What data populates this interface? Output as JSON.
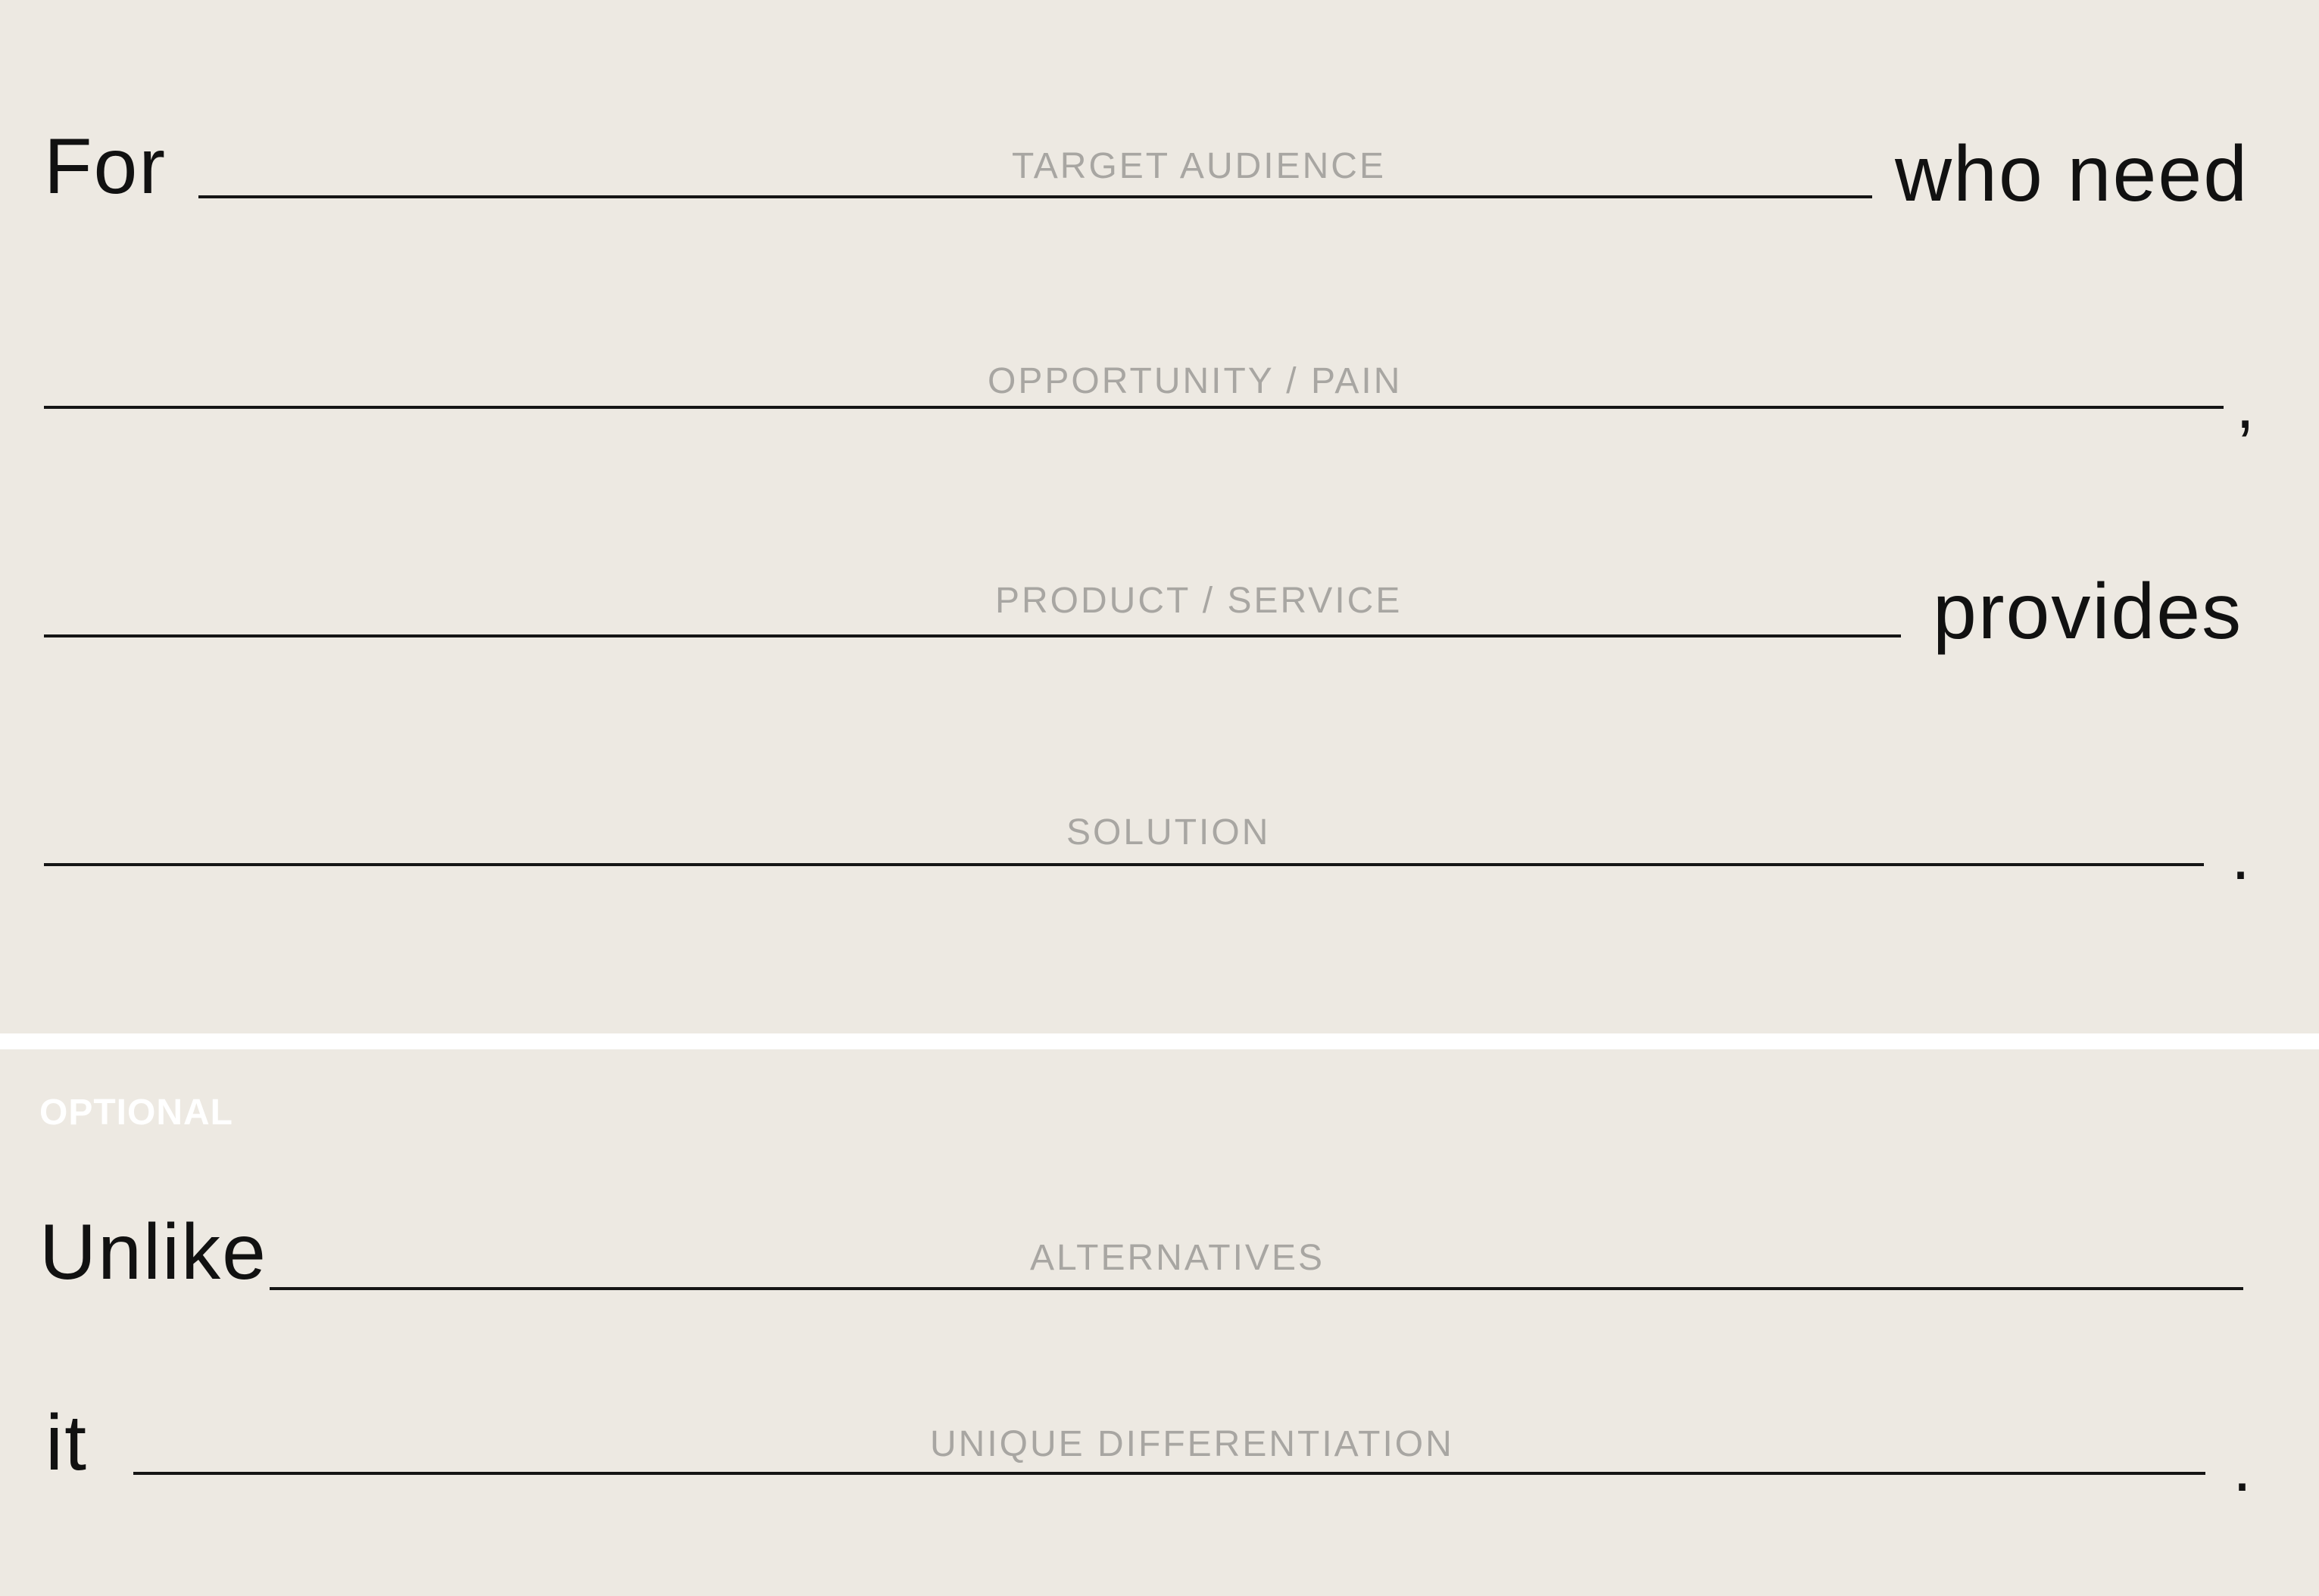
{
  "statement": {
    "for_word": "For",
    "who_need_word": "who need",
    "comma": ",",
    "provides_word": "provides",
    "period": ".",
    "target_audience_hint": "TARGET AUDIENCE",
    "opportunity_hint": "OPPORTUNITY / PAIN",
    "product_hint": "PRODUCT / SERVICE",
    "solution_hint": "SOLUTION"
  },
  "optional": {
    "badge": "OPTIONAL",
    "unlike_word": "Unlike",
    "alternatives_hint": "ALTERNATIVES",
    "it_word": "it",
    "unique_hint": "UNIQUE DIFFERENTIATION",
    "period": "."
  },
  "colors": {
    "background": "#ede9e2",
    "divider": "#ffffff",
    "text": "#111111",
    "hint": "#a8a6a2"
  }
}
